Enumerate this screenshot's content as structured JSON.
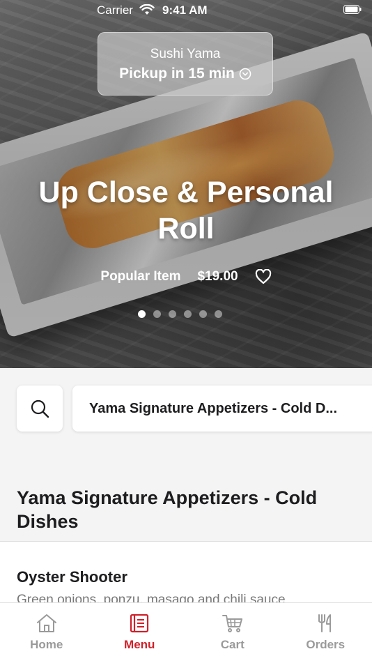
{
  "status_bar": {
    "carrier": "Carrier",
    "time": "9:41 AM"
  },
  "restaurant": {
    "name": "Sushi Yama",
    "pickup": "Pickup in 15 min"
  },
  "featured": {
    "title": "Up Close & Personal Roll",
    "badge": "Popular Item",
    "price": "$19.00",
    "carousel_count": 6,
    "carousel_active": 0
  },
  "menu": {
    "category_selected": "Yama Signature Appetizers - Cold D...",
    "section_title": "Yama Signature Appetizers - Cold Dishes",
    "items": [
      {
        "name": "Oyster Shooter",
        "description": "Green onions, ponzu, masago and chili sauce"
      }
    ]
  },
  "tabs": [
    {
      "label": "Home",
      "icon": "home-icon",
      "active": false
    },
    {
      "label": "Menu",
      "icon": "menu-icon",
      "active": true
    },
    {
      "label": "Cart",
      "icon": "cart-icon",
      "active": false
    },
    {
      "label": "Orders",
      "icon": "orders-icon",
      "active": false
    }
  ],
  "colors": {
    "accent": "#d0202a",
    "inactive_tab": "#9a9a9a"
  }
}
